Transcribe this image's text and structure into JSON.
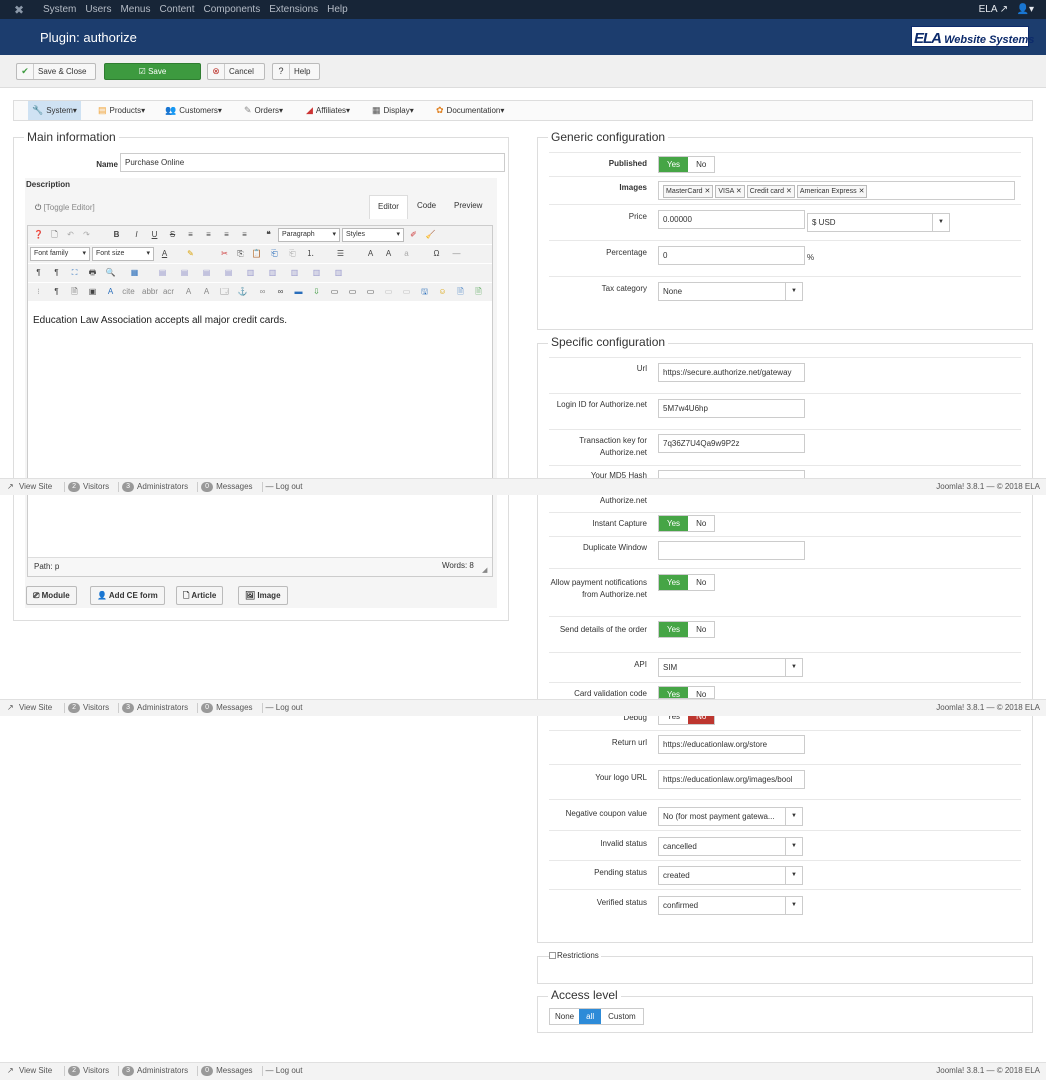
{
  "topnav": {
    "menu": [
      "System",
      "Users",
      "Menus",
      "Content",
      "Components",
      "Extensions",
      "Help"
    ],
    "site_name": "ELA",
    "user_icon": "user-icon"
  },
  "header": {
    "title": "Plugin: authorize",
    "logo_text_a": "ELA",
    "logo_text_b": "Website Systems"
  },
  "toolbar": {
    "save_close": "Save & Close",
    "save": "Save",
    "cancel": "Cancel",
    "help": "Help"
  },
  "appmenu": [
    "System",
    "Products",
    "Customers",
    "Orders",
    "Affiliates",
    "Display",
    "Documentation"
  ],
  "main": {
    "legend": "Main information",
    "name_label": "Name",
    "name_value": "Purchase Online",
    "description_label": "Description",
    "toggle_editor": "[Toggle Editor]",
    "tabs": [
      "Editor",
      "Code",
      "Preview"
    ],
    "paragraph": "Paragraph",
    "styles": "Styles",
    "font_family": "Font family",
    "font_size": "Font size",
    "content": "Education Law Association accepts all major credit cards.",
    "path": "Path: p",
    "words": "Words: 8",
    "buttons": [
      "Module",
      "Add CE form",
      "Article",
      "Image"
    ]
  },
  "generic": {
    "legend": "Generic configuration",
    "published_label": "Published",
    "yes": "Yes",
    "no": "No",
    "images_label": "Images",
    "images": [
      "MasterCard",
      "VISA",
      "Credit card",
      "American Express"
    ],
    "price_label": "Price",
    "price_value": "0.00000",
    "currency": "$ USD",
    "percentage_label": "Percentage",
    "percentage_value": "0",
    "percent_sign": "%",
    "tax_label": "Tax category",
    "tax_value": "None"
  },
  "specific": {
    "legend": "Specific configuration",
    "url_label": "Url",
    "url_value": "https://secure.authorize.net/gateway",
    "login_label": "Login ID for Authorize.net",
    "login_value": "5M7w4U6hp",
    "trans_label": "Transaction key for Authorize.net",
    "trans_value": "7q36Z7U4Qa9w9P2z",
    "md5_label_top": "Your MD5 Hash",
    "md5_label_bottom": "Authorize.net",
    "instant_label": "Instant Capture",
    "dup_label": "Duplicate Window",
    "allow_label": "Allow payment notifications from Authorize.net",
    "send_label": "Send details of the order",
    "api_label": "API",
    "api_value": "SIM",
    "card_label": "Card validation code",
    "debug_label": "Debug",
    "return_label": "Return url",
    "return_value": "https://educationlaw.org/store",
    "logo_label": "Your logo URL",
    "logo_value": "https://educationlaw.org/images/bool",
    "neg_label": "Negative coupon value",
    "neg_value": "No (for most payment gatewa...",
    "invalid_label": "Invalid status",
    "invalid_value": "cancelled",
    "pending_label": "Pending status",
    "pending_value": "created",
    "verified_label": "Verified status",
    "verified_value": "confirmed"
  },
  "restrictions": {
    "label": "Restrictions"
  },
  "access": {
    "legend": "Access level",
    "options": [
      "None",
      "all",
      "Custom"
    ]
  },
  "statusbar": {
    "view_site": "View Site",
    "visitors_count": "2",
    "visitors": "Visitors",
    "admins_count": "3",
    "admins": "Administrators",
    "messages_count": "0",
    "messages": "Messages",
    "logout": "Log out",
    "version": "Joomla! 3.8.1 — © 2018 ELA"
  }
}
